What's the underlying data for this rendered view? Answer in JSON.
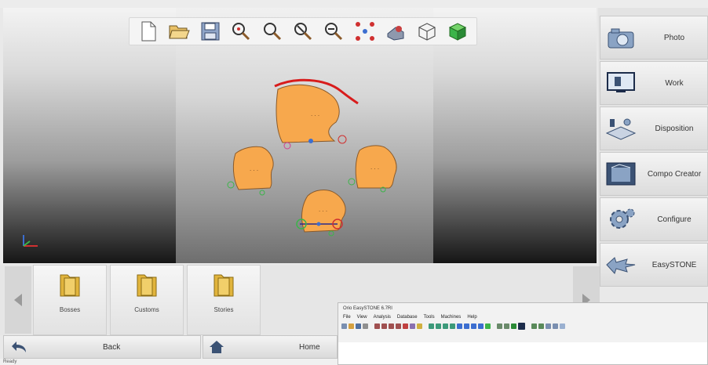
{
  "sidebar": {
    "items": [
      {
        "label": "Photo",
        "icon": "camera-icon"
      },
      {
        "label": "Work",
        "icon": "monitor-icon"
      },
      {
        "label": "Disposition",
        "icon": "disposition-icon"
      },
      {
        "label": "Compo Creator",
        "icon": "compo-creator-icon"
      },
      {
        "label": "Configure",
        "icon": "gear-icon"
      },
      {
        "label": "EasySTONE",
        "icon": "easystone-logo-icon"
      }
    ]
  },
  "toolbar": {
    "tools": [
      "new-file-icon",
      "open-folder-icon",
      "save-icon",
      "zoom-all-icon",
      "zoom-icon",
      "zoom-in-icon",
      "zoom-out-icon",
      "fit-points-icon",
      "view-icon",
      "wireframe-cube-icon",
      "solid-cube-icon"
    ]
  },
  "folders": [
    {
      "label": "Bosses"
    },
    {
      "label": "Customs"
    },
    {
      "label": "Stories"
    }
  ],
  "nav": {
    "back_label": "Back",
    "home_label": "Home"
  },
  "status": {
    "text": "Ready"
  },
  "inset": {
    "title": "Orio EasySTONE 6.7RI",
    "menu": [
      "File",
      "View",
      "Analysis",
      "Database",
      "Tools",
      "Machines",
      "Help"
    ]
  },
  "colors": {
    "shape_fill": "#f7a84d",
    "shape_outline": "#8a5a2a",
    "red_curve": "#d81c1c",
    "accent_green": "#3cb44a"
  }
}
